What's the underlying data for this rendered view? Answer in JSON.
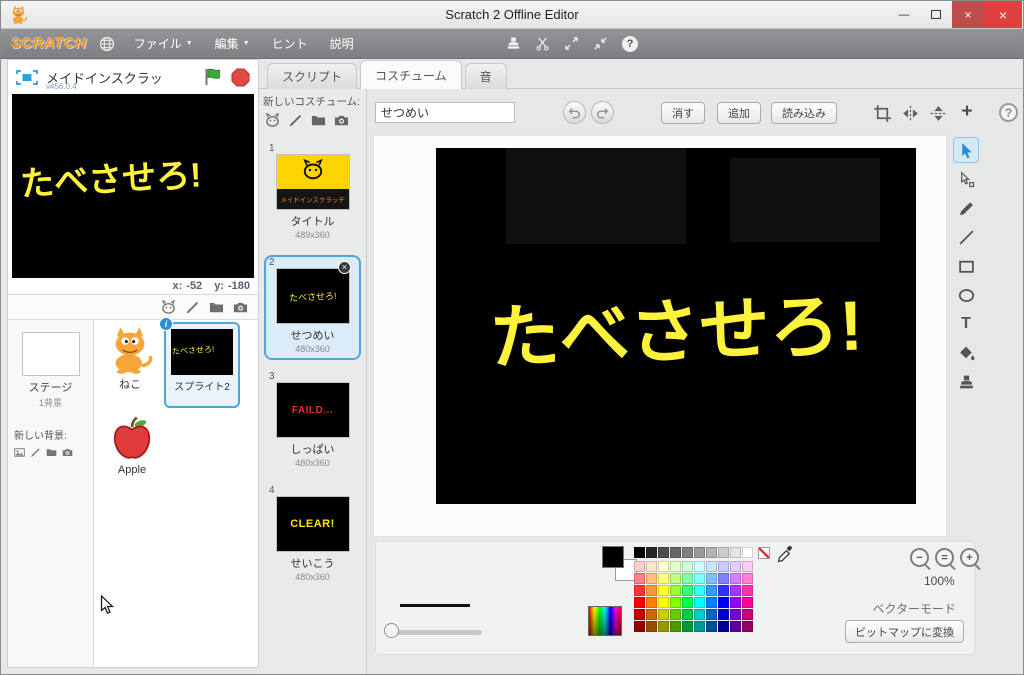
{
  "window": {
    "title": "Scratch 2 Offline Editor"
  },
  "icons": {
    "dropdown": "▼",
    "plus": "+",
    "help": "?",
    "info": "i",
    "delete_x": "×",
    "close": "×",
    "minimize": "—",
    "text_tool": "T",
    "zoom_out": "−",
    "zoom_reset": "=",
    "zoom_in": "+"
  },
  "menu": {
    "logo": "SCRATCH",
    "items": [
      {
        "label": "ファイル"
      },
      {
        "label": "編集"
      },
      {
        "label": "ヒント"
      },
      {
        "label": "説明"
      }
    ]
  },
  "stage_panel": {
    "project_name": "メイドインスクラッ",
    "version": "v456.0.4",
    "stage_text": "たべさせろ!",
    "coords": {
      "x_label": "x:",
      "x_value": "-52",
      "y_label": "y:",
      "y_value": "-180"
    }
  },
  "sprite_panel": {
    "stage_thumb_label": "ステージ",
    "stage_thumb_sub": "1背景",
    "new_backdrop_label": "新しい背景:",
    "sprites": [
      {
        "name": "ねこ"
      },
      {
        "name": "スプライト2",
        "thumb_text": "たべさせろ!"
      },
      {
        "name": "Apple"
      }
    ]
  },
  "tabs": [
    {
      "label": "スクリプト"
    },
    {
      "label": "コスチューム"
    },
    {
      "label": "音"
    }
  ],
  "costume_panel": {
    "new_costume_label": "新しいコスチューム:",
    "items": [
      {
        "index": "1",
        "name": "タイトル",
        "size": "489x360",
        "thumb_text": "メイドインスクラッチ"
      },
      {
        "index": "2",
        "name": "せつめい",
        "size": "480x360",
        "thumb_text": "たべさせろ!"
      },
      {
        "index": "3",
        "name": "しっぱい",
        "size": "480x360",
        "thumb_text": "FAILD..."
      },
      {
        "index": "4",
        "name": "せいこう",
        "size": "480x360",
        "thumb_text": "CLEAR!"
      }
    ]
  },
  "paint": {
    "name_value": "せつめい",
    "clear_label": "消す",
    "add_label": "追加",
    "import_label": "読み込み",
    "canvas_text": "たべさせろ!",
    "zoom_level": "100%",
    "mode_label": "ベクターモード",
    "convert_label": "ビットマップに変換",
    "canvas_color": "#000000",
    "drawing_color": "#FFF23D"
  },
  "palette": {
    "grayscale": [
      "#000000",
      "#262626",
      "#4d4d4d",
      "#666666",
      "#808080",
      "#999999",
      "#b3b3b3",
      "#cccccc",
      "#e6e6e6",
      "#ffffff"
    ],
    "rows": [
      [
        "#ffcccc",
        "#ffe5cc",
        "#ffffcc",
        "#e5ffcc",
        "#ccffdd",
        "#ccffff",
        "#cce5ff",
        "#ccccff",
        "#e5ccff",
        "#ffccee"
      ],
      [
        "#ff8080",
        "#ffbf80",
        "#ffff80",
        "#bfff80",
        "#80ffaa",
        "#80ffff",
        "#80bfff",
        "#8080ff",
        "#d580ff",
        "#ff80d5"
      ],
      [
        "#ff3333",
        "#ff9933",
        "#ffff33",
        "#99ff33",
        "#33ff77",
        "#33ffff",
        "#3399ff",
        "#3333ff",
        "#aa33ff",
        "#ff33aa"
      ],
      [
        "#ff0000",
        "#ff8000",
        "#ffff00",
        "#80ff00",
        "#00ff55",
        "#00ffff",
        "#0080ff",
        "#0000ff",
        "#9900ff",
        "#ff0099"
      ],
      [
        "#cc0000",
        "#cc6600",
        "#cccc00",
        "#66cc00",
        "#00cc44",
        "#00cccc",
        "#0066cc",
        "#0000cc",
        "#7a00cc",
        "#cc007a"
      ],
      [
        "#990000",
        "#994d00",
        "#999900",
        "#4d9900",
        "#009933",
        "#009999",
        "#004d99",
        "#000099",
        "#5c0099",
        "#99005c"
      ]
    ]
  }
}
